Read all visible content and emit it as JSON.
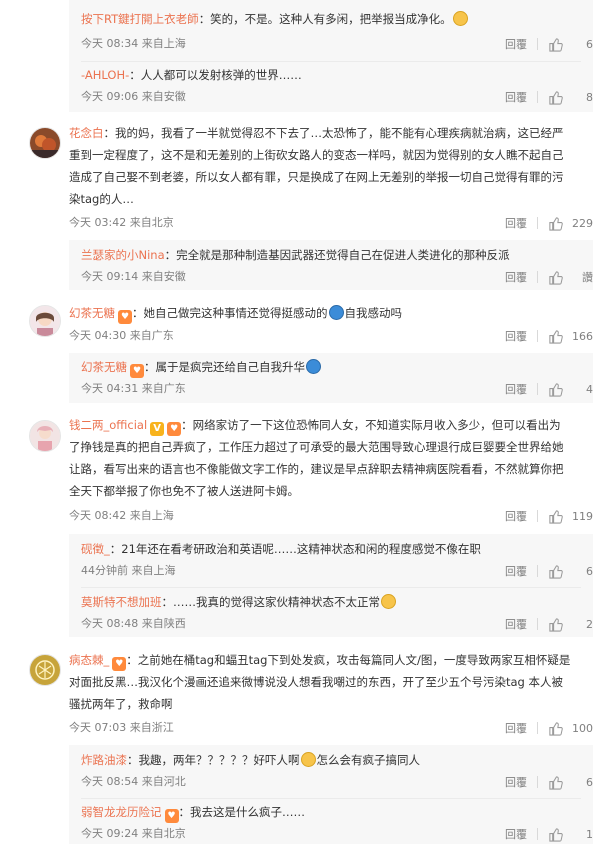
{
  "ui": {
    "reply_label": "回覆",
    "like_icon": "thumb-up-icon"
  },
  "comments": [
    {
      "user": "按下RT鍵打開上衣老師",
      "text": "：笑的，不是。这种人有多闲，把举报当成净化。",
      "time": "今天 08:34 来自上海",
      "likes": "6"
    },
    {
      "user": "-AHLOH-",
      "text": "：人人都可以发射核弹的世界……",
      "time": "今天 09:06 来自安徽",
      "likes": "8"
    },
    {
      "user": "花念白",
      "lines": [
        "：我的妈，我看了一半就觉得忍不下去了…太恐怖了，能不能有心理疾病就治病，这已经严",
        "重到一定程度了，这不是和无差别的上街砍女路人的变态一样吗，就因为觉得别的女人瞧不起自己",
        "造成了自己娶不到老婆，所以女人都有罪，只是换成了在网上无差别的举报一切自己觉得有罪的污",
        "染tag的人…"
      ],
      "time": "今天 03:42 来自北京",
      "likes": "229",
      "replies": [
        {
          "user": "兰瑟家的小Nina",
          "text": "：完全就是那种制造基因武器还觉得自己在促进人类进化的那种反派",
          "time": "今天 09:14 来自安徽",
          "likes": "讚"
        }
      ]
    },
    {
      "user": "幻茶无糖",
      "text": "：她自己做完这种事情还觉得挺感动的",
      "text_after": "自我感动吗",
      "time": "今天 04:30 来自广东",
      "likes": "166",
      "replies": [
        {
          "user": "幻茶无糖",
          "text": "：属于是疯完还给自己自我升华",
          "time": "今天 04:31 来自广东",
          "likes": "4"
        }
      ]
    },
    {
      "user": "钱二两_official",
      "lines": [
        "：网络家访了一下这位恐怖同人女，不知道实际月收入多少，但可以看出为",
        "了挣钱是真的把自己弄疯了，工作压力超过了可承受的最大范围导致心理退行成巨婴要全世界给她",
        "让路，看写出来的语言也不像能做文字工作的，建议是早点辞职去精神病医院看看，不然就算你把",
        "全天下都举报了你也免不了被人送进阿卡姆。"
      ],
      "time": "今天 08:42 来自上海",
      "likes": "119",
      "replies": [
        {
          "user": "砚徵_",
          "text": "：21年还在看考研政治和英语呢……这精神状态和闲的程度感觉不像在职",
          "time": "44分钟前 来自上海",
          "likes": "6"
        },
        {
          "user": "莫斯特不想加班",
          "text": "：……我真的觉得这家伙精神状态不太正常",
          "time": "今天 08:48 来自陕西",
          "likes": "2"
        }
      ]
    },
    {
      "user": "病态棘_",
      "lines": [
        "：之前她在桶tag和蝠丑tag下到处发疯，攻击每篇同人文/图，一度导致两家互相怀疑是",
        "对面批反黑…我汉化个漫画还追来微博说没人想看我嘲过的东西，开了至少五个号污染tag 本人被",
        "骚扰两年了，救命啊"
      ],
      "time": "今天 07:03 来自浙江",
      "likes": "100",
      "replies": [
        {
          "user": "炸路油漆",
          "text": "：我趣，两年？？？？？好吓人啊",
          "text_after": "怎么会有疯子搞同人",
          "time": "今天 08:54 来自河北",
          "likes": "6"
        },
        {
          "user": "弱智龙龙历险记",
          "text": "：我去这是什么疯子……",
          "time": "今天 09:24 来自北京",
          "likes": "1"
        }
      ]
    }
  ]
}
